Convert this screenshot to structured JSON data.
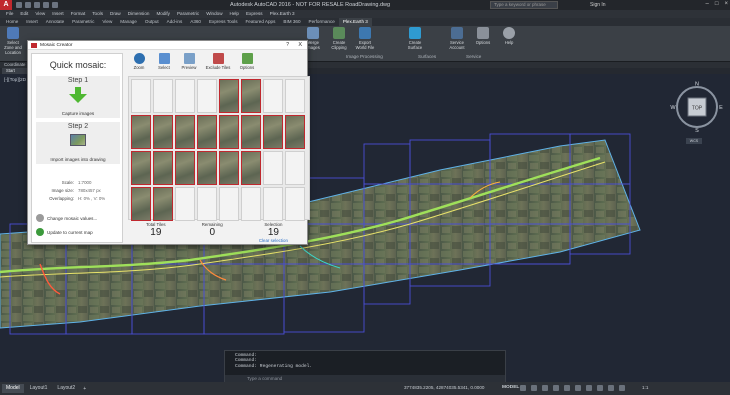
{
  "titlebar": {
    "title": "Autodesk AutoCAD 2016 - NOT FOR RESALE   RoadDrawing.dwg",
    "search_placeholder": "Type a keyword or phrase",
    "signin": "Sign In"
  },
  "menubar": [
    "File",
    "Edit",
    "View",
    "Insert",
    "Format",
    "Tools",
    "Draw",
    "Dimension",
    "Modify",
    "Parametric",
    "Window",
    "Help",
    "Express",
    "Plex.Earth 3"
  ],
  "tabs": [
    "Home",
    "Insert",
    "Annotate",
    "Parametric",
    "View",
    "Manage",
    "Output",
    "Add-ins",
    "A360",
    "Express Tools",
    "Featured Apps",
    "BIM 360",
    "Performance",
    "Plex.Earth 3"
  ],
  "active_tab": "Plex.Earth 3",
  "ribbon": {
    "left_btn": "Select Zone and Location",
    "buttons": [
      "Merge Images",
      "Create Clipping",
      "Export World File",
      "Create Surface",
      "Service Account",
      "Options",
      "Help"
    ],
    "groups": [
      "Image Processing",
      "Surfaces",
      "Service"
    ]
  },
  "subbar": "Coordinate S",
  "file_tab": "Start",
  "viewport_label": "[-][Top][2D Wireframe]",
  "viewcube": {
    "n": "N",
    "s": "S",
    "e": "E",
    "w": "W",
    "top": "TOP",
    "wcs": "WCS"
  },
  "dialog": {
    "title": "Mosaic Creator",
    "help": "?",
    "close": "X",
    "quick_title": "Quick mosaic:",
    "step1_title": "Step 1",
    "step1_text": "Capture images",
    "step2_title": "Step 2",
    "step2_text": "Import images into drawing",
    "props": [
      {
        "k": "Scale:",
        "v": "1:7000"
      },
      {
        "k": "Image size:",
        "v": "780x457 px"
      },
      {
        "k": "Overlapping:",
        "v": "H: 0% , V: 0%"
      }
    ],
    "change_link": "Change mosaic values...",
    "update_link": "Update to current map",
    "toolbar": [
      "Zoom",
      "Select",
      "Preview",
      "Exclude Tiles",
      "Options"
    ],
    "total_label": "Total Tiles",
    "total_value": "19",
    "remaining_label": "Remaining",
    "remaining_value": "0",
    "selection_label": "Selection",
    "selection_value": "19",
    "clear": "Clear selection"
  },
  "command": {
    "lines": [
      "Command:",
      "Command:",
      "Command: Regenerating model."
    ],
    "placeholder": "Type a command"
  },
  "status": {
    "tabs": [
      "Model",
      "Layout1",
      "Layout2"
    ],
    "coords": "3774835.2205, 42874035.5341, 0.0000",
    "model": "MODEL",
    "scale": "1:1"
  },
  "colors": {
    "accent": "#c0282e",
    "boundary": "#3a5bd0",
    "road": "#8bd44a"
  }
}
